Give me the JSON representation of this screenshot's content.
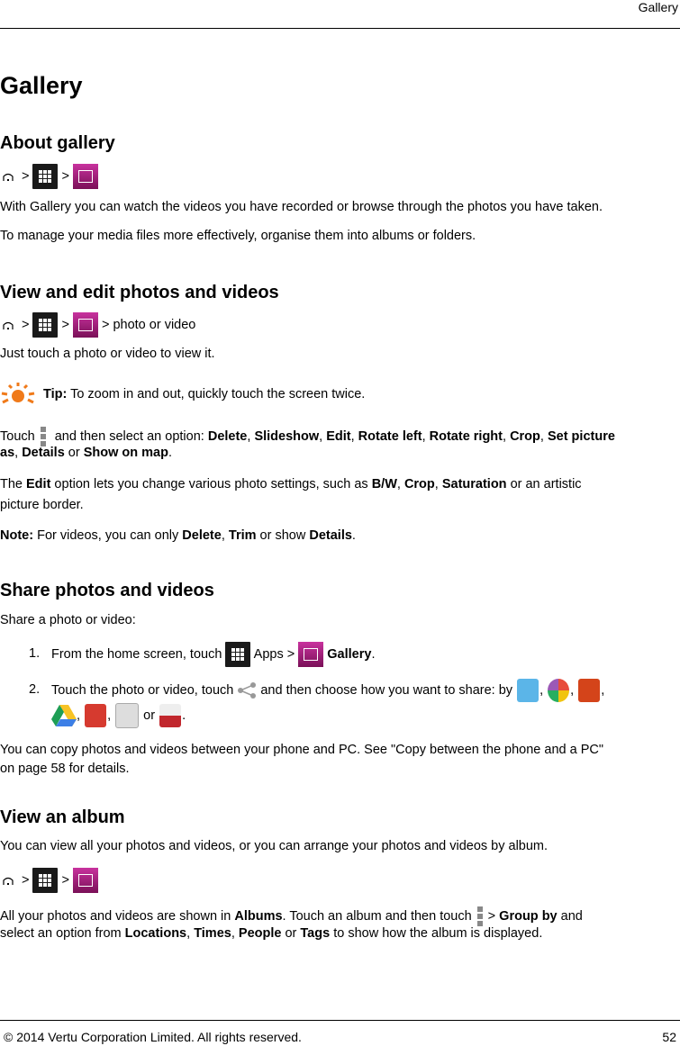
{
  "header": {
    "running_title": "Gallery"
  },
  "page_title": "Gallery",
  "sections": {
    "about": {
      "heading": "About gallery",
      "path_sep": ">",
      "para1": "With Gallery you can watch the videos you have recorded or browse through the photos you have taken.",
      "para2": "To manage your media files more effectively, organise them into albums or folders."
    },
    "view_edit": {
      "heading": "View and edit photos and videos",
      "path_suffix": "> photo or video",
      "para1": "Just touch a photo or video to view it.",
      "tip_label": "Tip:",
      "tip_text": " To zoom in and out, quickly touch the screen twice.",
      "touch_prefix": "Touch",
      "touch_mid": " and then select an option: ",
      "options": [
        "Delete",
        "Slideshow",
        "Edit",
        "Rotate left",
        "Rotate right",
        "Crop",
        "Set picture as",
        "Details",
        "Show on map"
      ],
      "edit_pre": "The ",
      "edit_word": "Edit",
      "edit_mid": " option lets you change various photo settings, such as ",
      "edit_opts": [
        "B/W",
        "Crop",
        "Saturation"
      ],
      "edit_tail1": " or an artistic",
      "edit_tail2": "picture border.",
      "note_label": "Note:",
      "note_pre": " For videos, you can only ",
      "note_opts": [
        "Delete",
        "Trim",
        "Details"
      ],
      "note_or": " or show ",
      "period": "."
    },
    "share": {
      "heading": "Share photos and videos",
      "intro": "Share a photo or video:",
      "step1_num": "1.",
      "step1_pre": "From the home screen, touch",
      "step1_apps": "Apps >",
      "step1_gallery": "Gallery",
      "step2_num": "2.",
      "step2_pre": "Touch the photo or video, touch",
      "step2_mid": "and then choose how you want to share: by",
      "step2_or": "or",
      "share_icons": [
        "bluetooth-icon",
        "picasa-icon",
        "messaging-icon",
        "drive-icon",
        "google-plus-icon",
        "gmail-icon",
        "youtube-icon"
      ],
      "copy1": "You can copy photos and videos between your phone and PC. See \"Copy between the phone and a PC\"",
      "copy2": "on page 58 for details."
    },
    "album": {
      "heading": "View an album",
      "intro": "You can view all your photos and videos, or you can arrange your photos and videos by album.",
      "l1_pre": "All your photos and videos are shown in ",
      "albums": "Albums",
      "l1_mid": ". Touch an album and then touch",
      "group_by_pre": "> ",
      "group_by": "Group by",
      "l1_end": " and",
      "l2_pre": "select an option from ",
      "opts": [
        "Locations",
        "Times",
        "People",
        "Tags"
      ],
      "l2_end": " to show how the album is displayed."
    }
  },
  "footer": {
    "copyright": "© 2014 Vertu Corporation Limited. All rights reserved.",
    "page_number": "52"
  },
  "colors": {
    "gallery_icon": "#b0268a",
    "apps_icon": "#1a1a1a",
    "tip_icon": "#f07a1a",
    "menu_icon": "#888888"
  }
}
